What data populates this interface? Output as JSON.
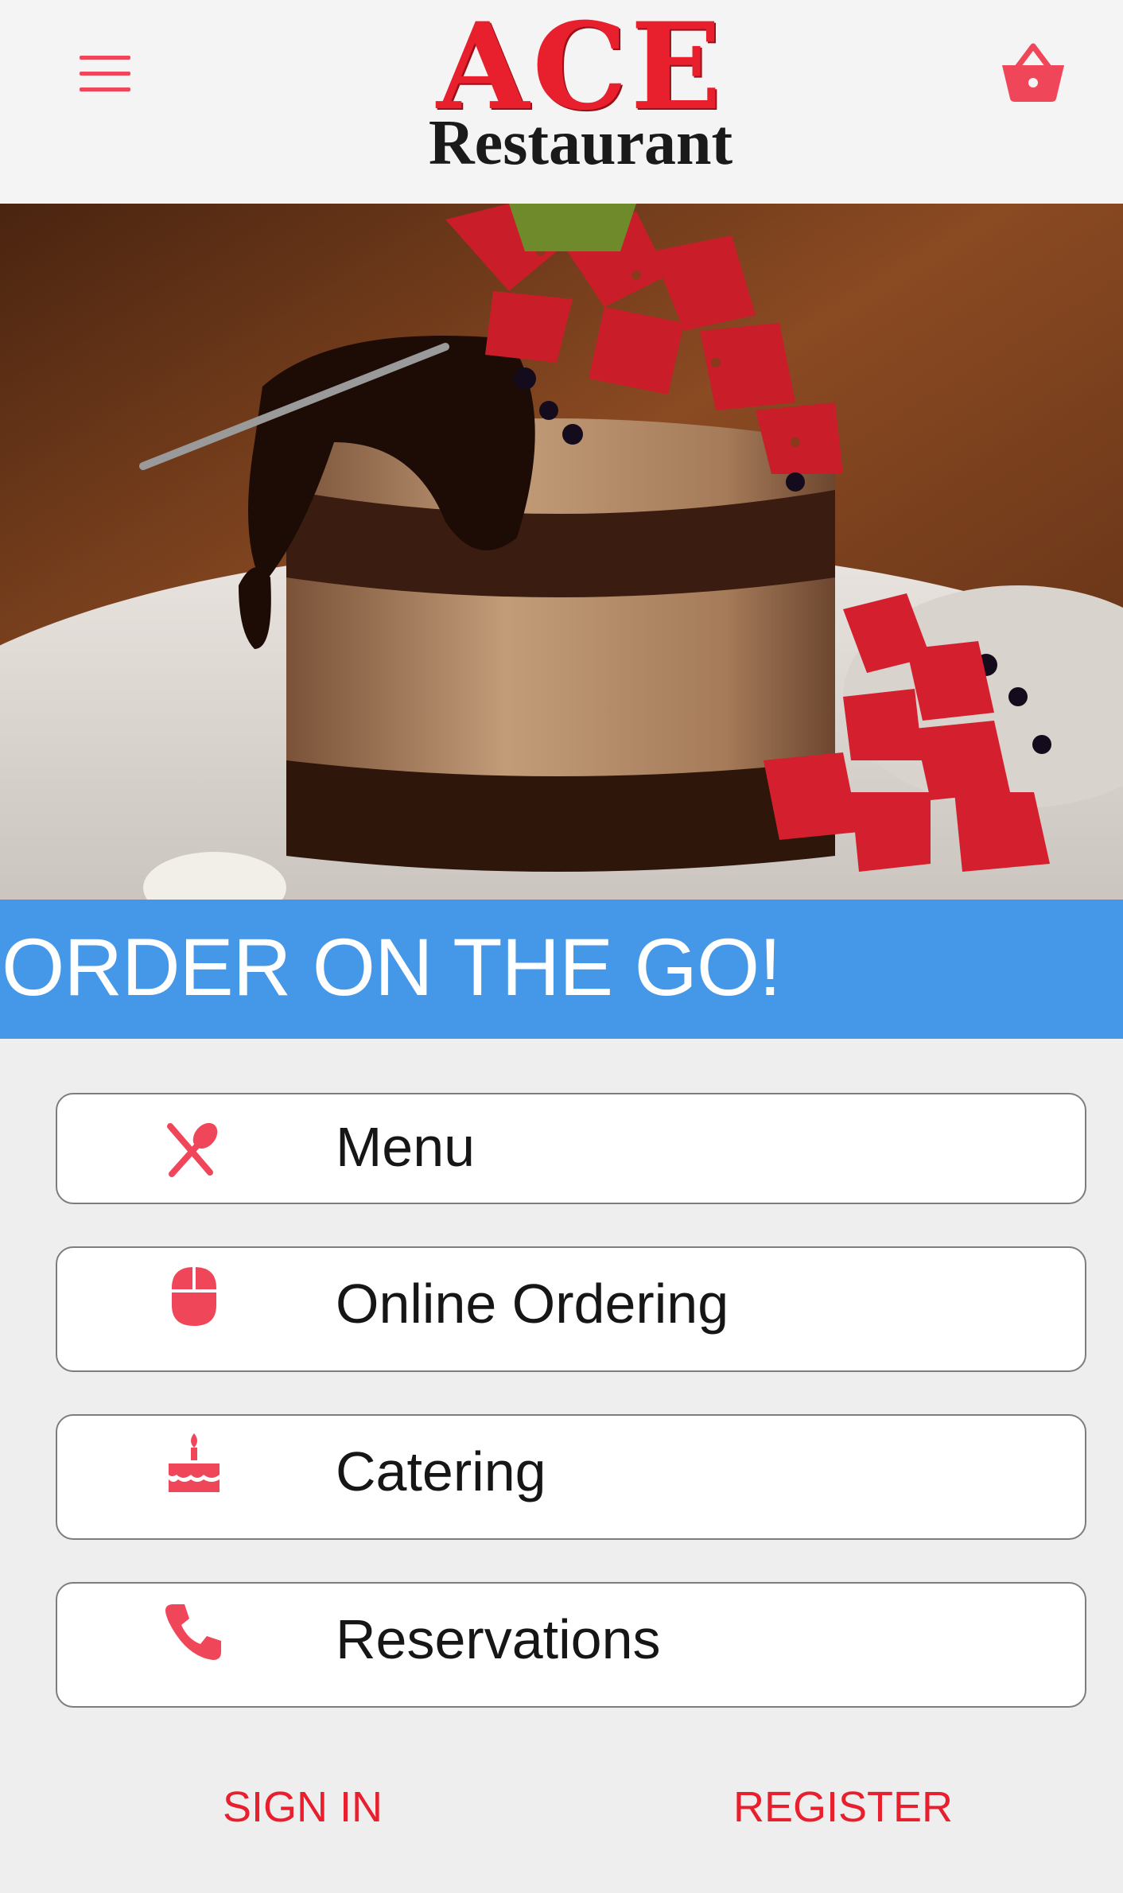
{
  "header": {
    "logo_title": "ACE",
    "logo_subtitle": "Restaurant",
    "menu_icon": "hamburger-menu-icon",
    "cart_icon": "shopping-basket-icon"
  },
  "hero": {
    "image": "chocolate mousse cake with strawberries"
  },
  "banner": {
    "text": "ORDER ON THE GO!"
  },
  "nav": {
    "items": [
      {
        "label": "Menu",
        "icon": "fork-spoon-icon"
      },
      {
        "label": "Online Ordering",
        "icon": "mouse-icon"
      },
      {
        "label": "Catering",
        "icon": "cake-icon"
      },
      {
        "label": "Reservations",
        "icon": "phone-icon"
      }
    ]
  },
  "auth": {
    "sign_in": "SIGN IN",
    "register": "REGISTER"
  },
  "colors": {
    "accent": "#f0465a",
    "logo_red": "#e8202e",
    "banner_blue": "#4597e8",
    "background": "#eeeeee"
  }
}
